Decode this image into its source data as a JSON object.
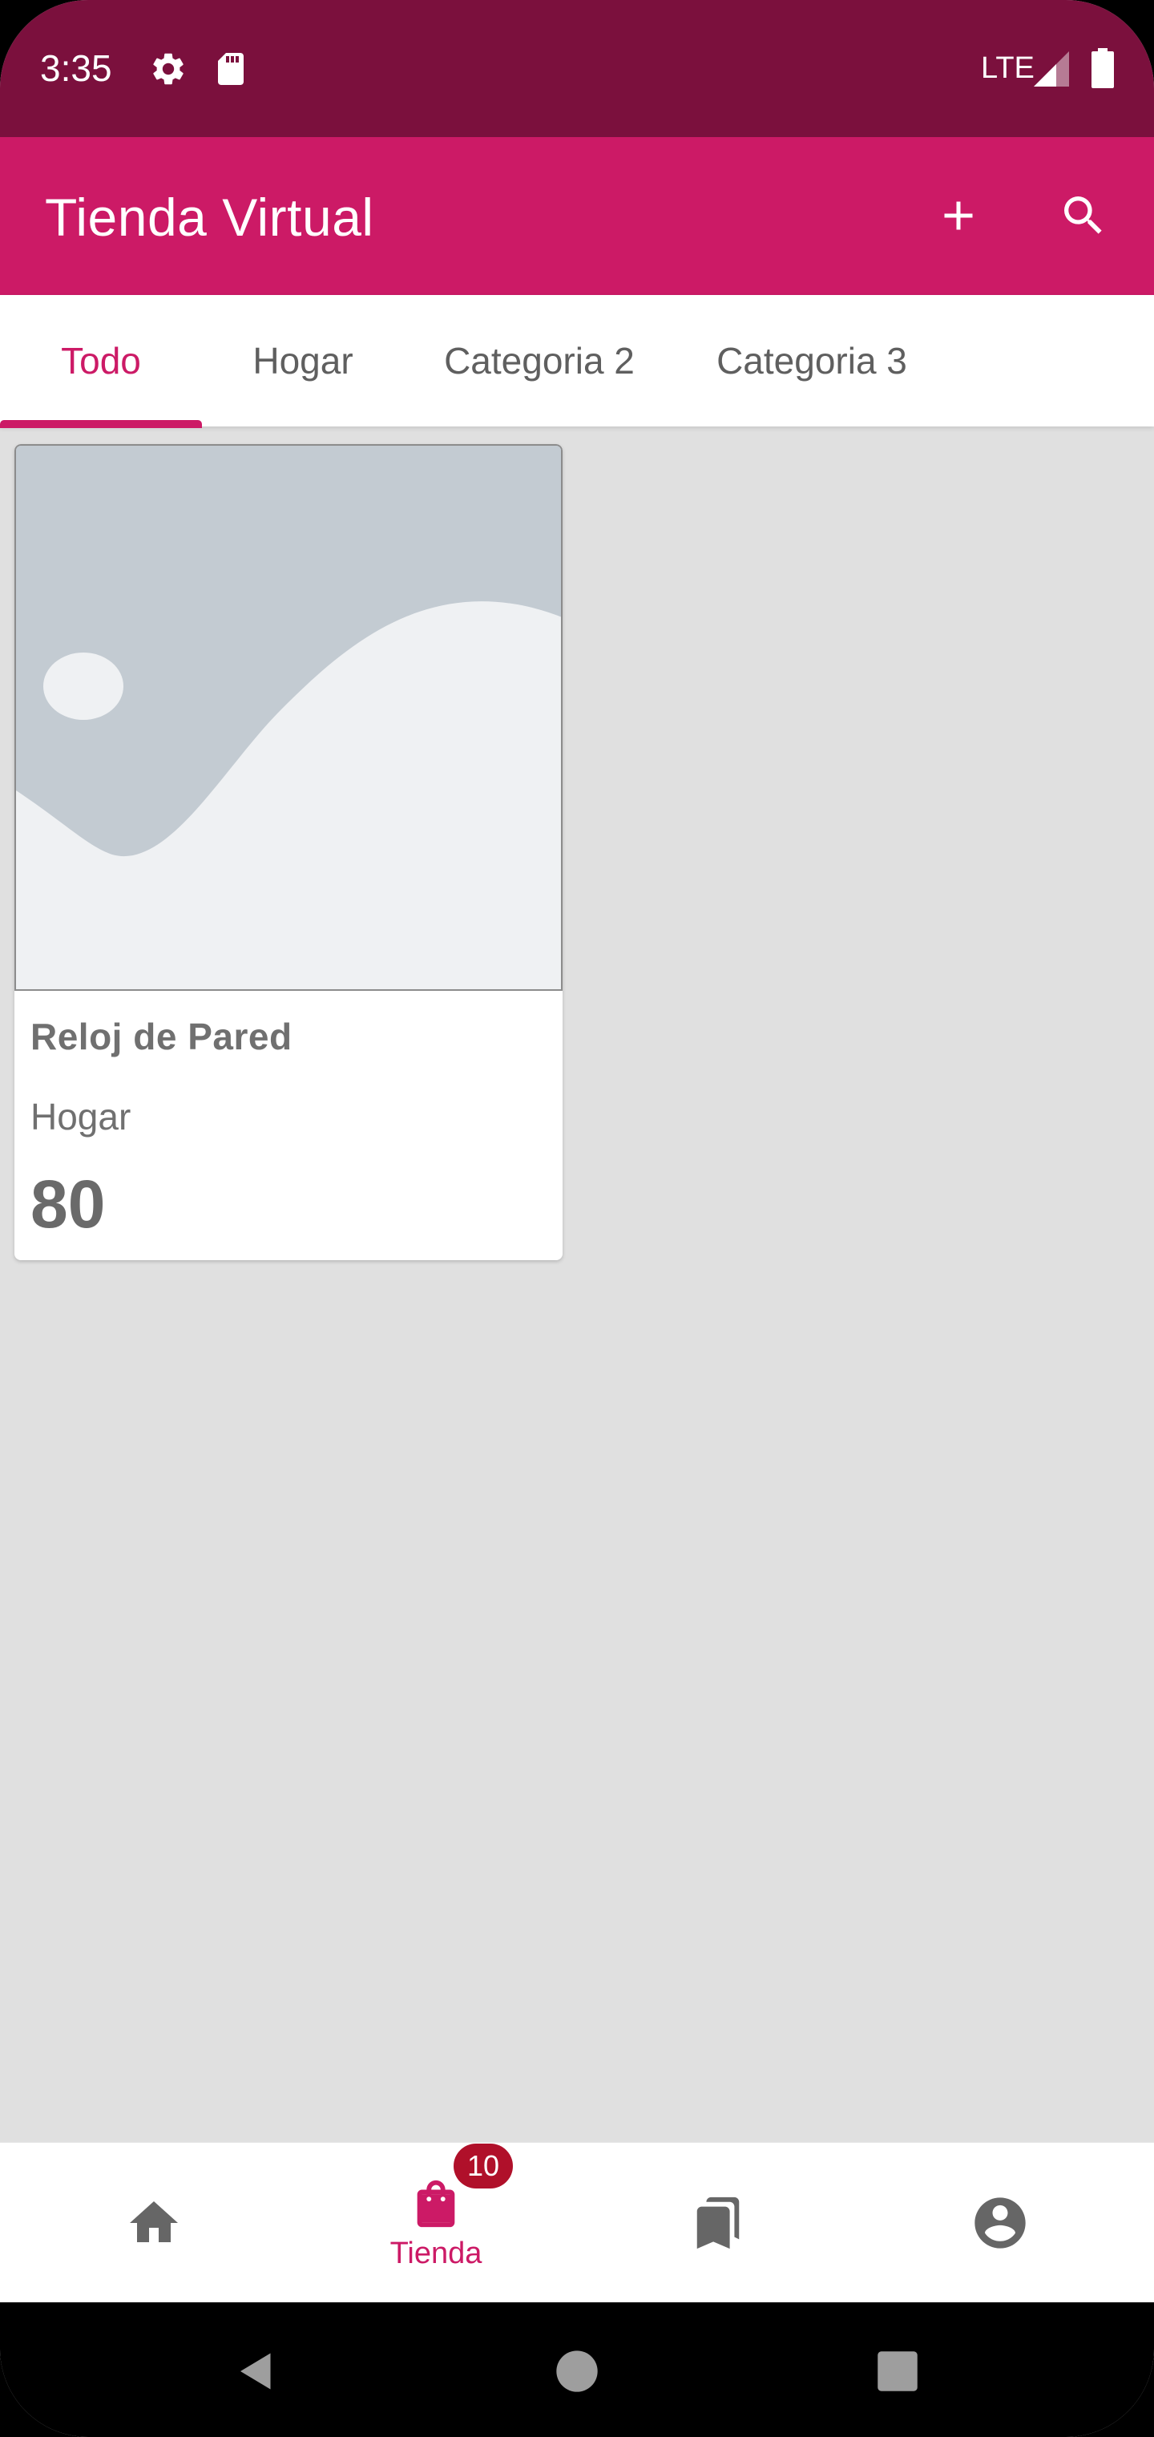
{
  "status_bar": {
    "time": "3:35",
    "network": "LTE"
  },
  "app_bar": {
    "title": "Tienda Virtual"
  },
  "tabs": [
    {
      "label": "Todo",
      "active": true
    },
    {
      "label": "Hogar",
      "active": false
    },
    {
      "label": "Categoria 2",
      "active": false
    },
    {
      "label": "Categoria 3",
      "active": false
    }
  ],
  "products": [
    {
      "name": "Reloj de Pared",
      "category": "Hogar",
      "price": "80"
    }
  ],
  "bottom_nav": {
    "items": [
      {
        "icon": "home-icon",
        "label": ""
      },
      {
        "icon": "shopping-bag-icon",
        "label": "Tienda",
        "badge": "10",
        "active": true
      },
      {
        "icon": "bookmarks-icon",
        "label": ""
      },
      {
        "icon": "account-circle-icon",
        "label": ""
      }
    ]
  },
  "colors": {
    "primary": "#cc1a66",
    "status_bar": "#7b103d",
    "badge": "#b0102a"
  }
}
